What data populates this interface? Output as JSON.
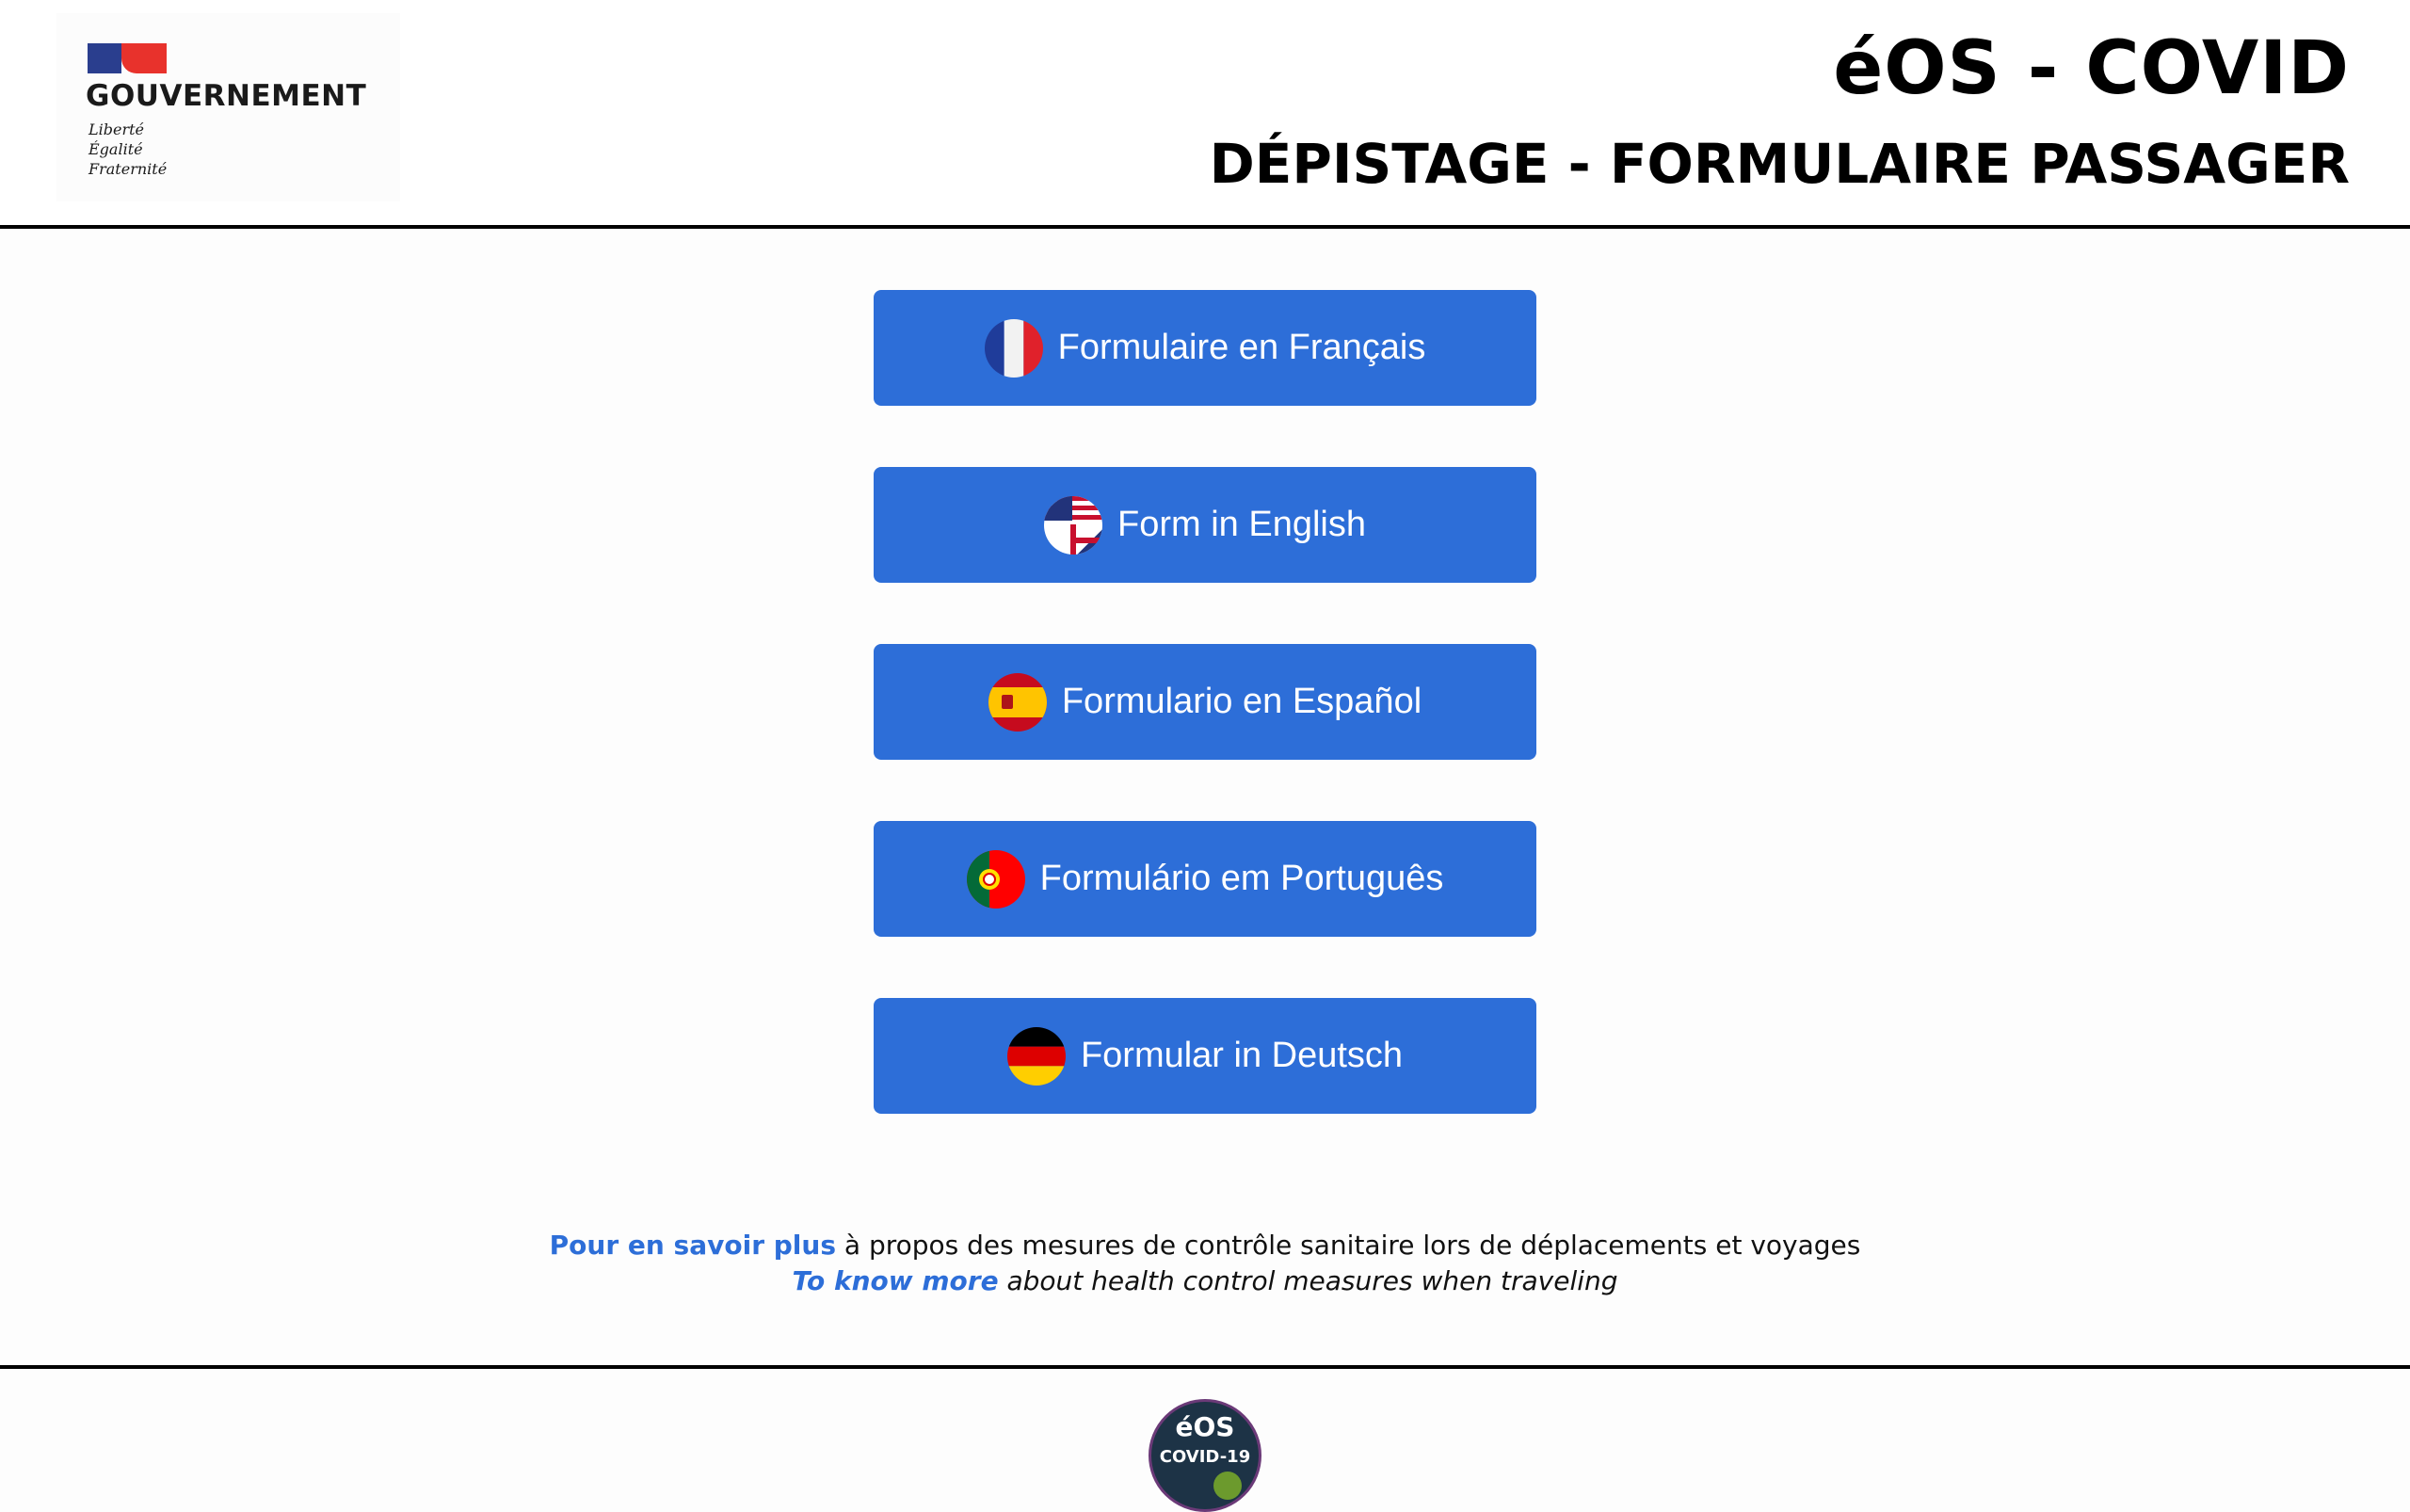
{
  "header": {
    "gov_name": "GOUVERNEMENT",
    "motto": [
      "Liberté",
      "Égalité",
      "Fraternité"
    ],
    "title": "éOS - COVID",
    "subtitle": "DÉPISTAGE - FORMULAIRE PASSAGER"
  },
  "languages": [
    {
      "label": "Formulaire en Français",
      "flag": "fr-flag-icon"
    },
    {
      "label": "Form in English",
      "flag": "us-uk-flag-icon"
    },
    {
      "label": "Formulario en Español",
      "flag": "es-flag-icon"
    },
    {
      "label": "Formulário em Português",
      "flag": "pt-flag-icon"
    },
    {
      "label": "Formular in Deutsch",
      "flag": "de-flag-icon"
    }
  ],
  "info": {
    "fr_link": "Pour en savoir plus",
    "fr_text": " à propos des mesures de contrôle sanitaire lors de déplacements et voyages",
    "en_link": "To know more",
    "en_text": " about health control measures when traveling"
  },
  "footer": {
    "logo_line1": "éOS",
    "logo_line2": "COVID-19"
  },
  "colors": {
    "button": "#2d6ed8",
    "link": "#2d6ed8",
    "gov_blue": "#2a3e8e",
    "gov_red": "#e8322c"
  }
}
